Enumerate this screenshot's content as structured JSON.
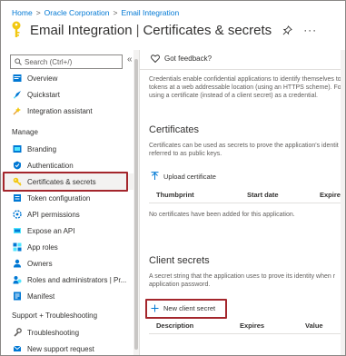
{
  "breadcrumb": {
    "items": [
      "Home",
      "Oracle Corporation",
      "Email Integration"
    ],
    "separator": ">"
  },
  "header": {
    "app_name": "Email Integration",
    "divider": "|",
    "page_title": "Certificates & secrets",
    "more": "···"
  },
  "sidebar": {
    "search_placeholder": "Search (Ctrl+/)",
    "collapse_glyph": "«",
    "top_items": [
      {
        "label": "Overview",
        "icon": "overview-icon"
      },
      {
        "label": "Quickstart",
        "icon": "quickstart-icon"
      },
      {
        "label": "Integration assistant",
        "icon": "integration-assistant-icon"
      }
    ],
    "manage_title": "Manage",
    "manage_items": [
      {
        "label": "Branding",
        "icon": "branding-icon"
      },
      {
        "label": "Authentication",
        "icon": "authentication-icon"
      },
      {
        "label": "Certificates & secrets",
        "icon": "key-icon",
        "selected": true
      },
      {
        "label": "Token configuration",
        "icon": "token-icon"
      },
      {
        "label": "API permissions",
        "icon": "api-permissions-icon"
      },
      {
        "label": "Expose an API",
        "icon": "expose-api-icon"
      },
      {
        "label": "App roles",
        "icon": "app-roles-icon"
      },
      {
        "label": "Owners",
        "icon": "owners-icon"
      },
      {
        "label": "Roles and administrators | Pr...",
        "icon": "roles-admin-icon"
      },
      {
        "label": "Manifest",
        "icon": "manifest-icon"
      }
    ],
    "support_title": "Support + Troubleshooting",
    "support_items": [
      {
        "label": "Troubleshooting",
        "icon": "troubleshooting-icon"
      },
      {
        "label": "New support request",
        "icon": "support-request-icon"
      }
    ]
  },
  "main": {
    "feedback_label": "Got feedback?",
    "intro_lines": [
      "Credentials enable confidential applications to identify themselves to",
      "tokens at a web addressable location (using an HTTPS scheme). For",
      "using a certificate (instead of a client secret) as a credential."
    ],
    "certificates": {
      "title": "Certificates",
      "desc_lines": [
        "Certificates can be used as secrets to prove the application's identit",
        "referred to as public keys."
      ],
      "upload_label": "Upload certificate",
      "columns": [
        "Thumbprint",
        "Start date",
        "Expires"
      ],
      "empty_text": "No certificates have been added for this application."
    },
    "client_secrets": {
      "title": "Client secrets",
      "desc_lines": [
        "A secret string that the application uses to prove its identity when r",
        "application password."
      ],
      "new_label": "New client secret",
      "columns": [
        "Description",
        "Expires",
        "Value"
      ]
    }
  },
  "colors": {
    "accent": "#0078d4",
    "highlight": "#a4262c",
    "key_yellow": "#f2c811"
  }
}
